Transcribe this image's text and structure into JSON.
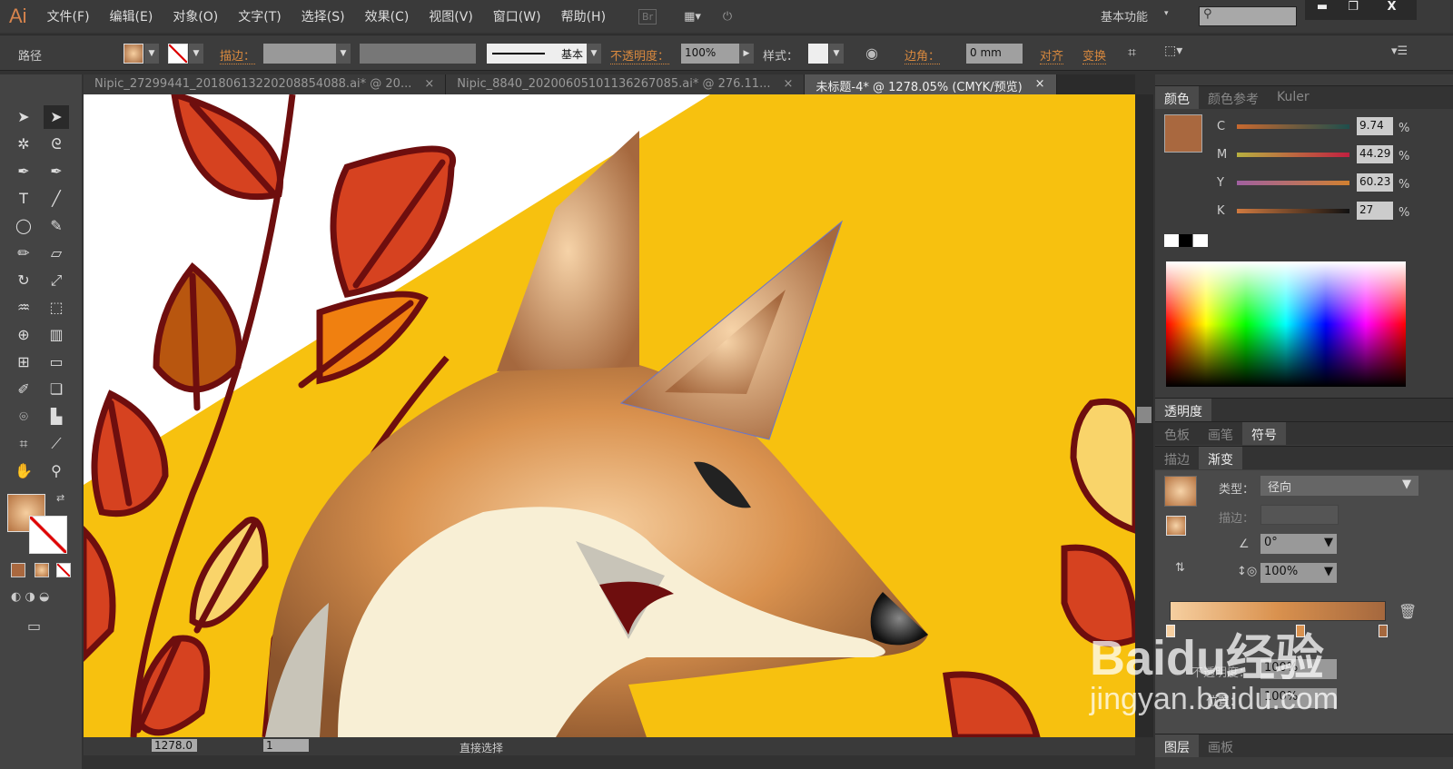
{
  "menubar": {
    "logo": "Ai",
    "items": [
      "文件(F)",
      "编辑(E)",
      "对象(O)",
      "文字(T)",
      "选择(S)",
      "效果(C)",
      "视图(V)",
      "窗口(W)",
      "帮助(H)"
    ],
    "br": "Br",
    "workspace": "基本功能",
    "search_placeholder": ""
  },
  "control": {
    "object_type": "路径",
    "stroke_label": "描边：",
    "stroke_style": "基本",
    "opacity_label": "不透明度：",
    "opacity": "100%",
    "style_label": "样式：",
    "corner_label": "边角：",
    "corner_value": "0 mm",
    "align": "对齐",
    "transform": "变换"
  },
  "tabs": [
    {
      "label": "Nipic_27299441_20180613220208854088.ai* @ 20..."
    },
    {
      "label": "Nipic_8840_20200605101136267085.ai* @ 276.11..."
    },
    {
      "label": "未标题-4* @ 1278.05% (CMYK/预览)"
    }
  ],
  "close_glyph": "×",
  "status": {
    "zoom": "1278.0",
    "artboard": "1",
    "tool": "直接选择"
  },
  "color_panel": {
    "tabs": [
      "颜色",
      "颜色参考",
      "Kuler"
    ],
    "channels": [
      {
        "label": "C",
        "value": "9.74"
      },
      {
        "label": "M",
        "value": "44.29"
      },
      {
        "label": "Y",
        "value": "60.23"
      },
      {
        "label": "K",
        "value": "27"
      }
    ],
    "pct": "%",
    "fill": "#a9683f"
  },
  "transparency_panel": {
    "title": "透明度"
  },
  "swatch_tabs": [
    "色板",
    "画笔",
    "符号"
  ],
  "gradient_panel": {
    "tabs": [
      "描边",
      "渐变"
    ],
    "type_label": "类型：",
    "type_value": "径向",
    "stroke_label": "描边：",
    "angle": "0°",
    "aspect": "100%",
    "opacity_label": "不透明度：",
    "opacity": "100%",
    "location_label": "位置：",
    "location": "100%",
    "stops": [
      "#f6cfa0",
      "#d9914e",
      "#a5683e"
    ]
  },
  "layers_tabs": [
    "图层",
    "画板"
  ],
  "watermark": {
    "text": "Baidu经验",
    "url": "jingyan.baidu.com"
  }
}
